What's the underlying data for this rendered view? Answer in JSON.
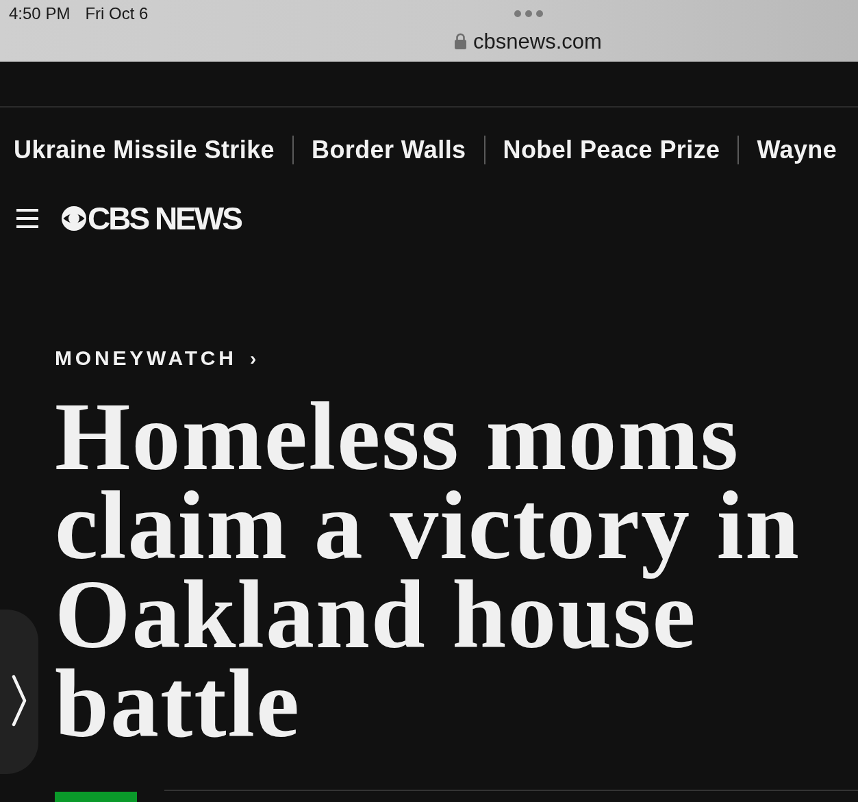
{
  "status_bar": {
    "time": "4:50 PM",
    "date": "Fri Oct 6"
  },
  "address_bar": {
    "url": "cbsnews.com",
    "secure": true
  },
  "trending": [
    {
      "label": "Ukraine Missile Strike"
    },
    {
      "label": "Border Walls"
    },
    {
      "label": "Nobel Peace Prize"
    },
    {
      "label": "Wayne"
    }
  ],
  "header": {
    "logo_text": "CBS NEWS"
  },
  "article": {
    "section": "MONEYWATCH",
    "section_arrow": "›",
    "headline": "Homeless moms claim a victory in Oakland house battle"
  }
}
